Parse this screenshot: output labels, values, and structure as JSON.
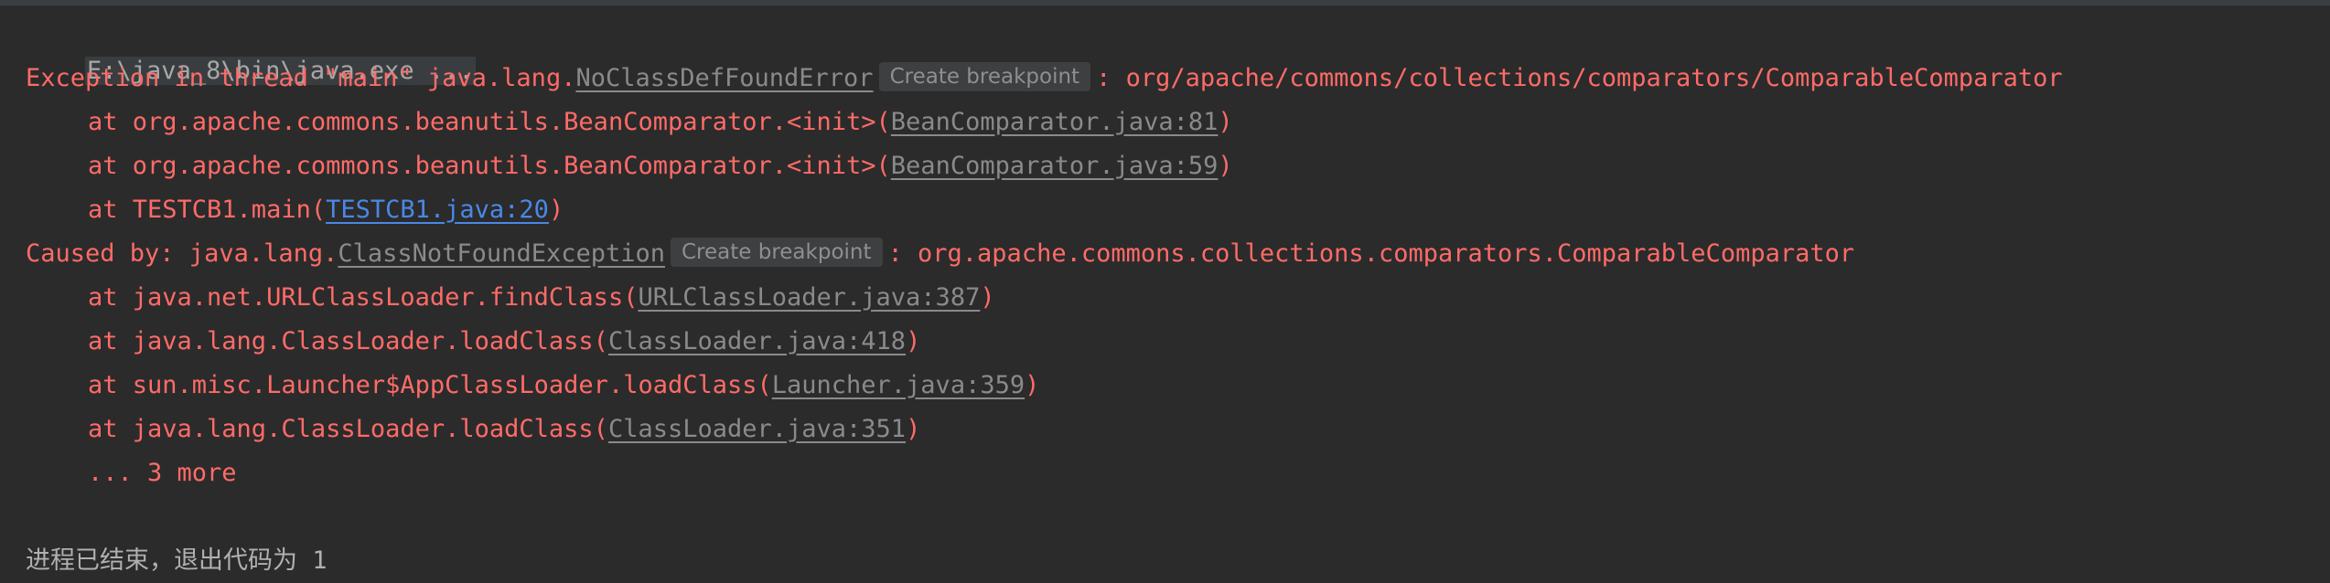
{
  "console": {
    "command": "E:\\java_8\\bin\\java.exe ...",
    "exception_prefix": "Exception in thread \"main\" java.lang.",
    "exception_class": "NoClassDefFoundError",
    "create_breakpoint_label": "Create breakpoint",
    "exception_message": ": org/apache/commons/collections/comparators/ComparableComparator",
    "stack1": [
      {
        "prefix": "at org.apache.commons.beanutils.BeanComparator.<init>(",
        "link": "BeanComparator.java:81",
        "suffix": ")"
      },
      {
        "prefix": "at org.apache.commons.beanutils.BeanComparator.<init>(",
        "link": "BeanComparator.java:59",
        "suffix": ")"
      },
      {
        "prefix": "at TESTCB1.main(",
        "link": "TESTCB1.java:20",
        "suffix": ")"
      }
    ],
    "caused_prefix": "Caused by: java.lang.",
    "caused_class": "ClassNotFoundException",
    "caused_message": ": org.apache.commons.collections.comparators.ComparableComparator",
    "stack2": [
      {
        "prefix": "at java.net.URLClassLoader.findClass(",
        "link": "URLClassLoader.java:387",
        "suffix": ")"
      },
      {
        "prefix": "at java.lang.ClassLoader.loadClass(",
        "link": "ClassLoader.java:418",
        "suffix": ")"
      },
      {
        "prefix": "at sun.misc.Launcher$AppClassLoader.loadClass(",
        "link": "Launcher.java:359",
        "suffix": ")"
      },
      {
        "prefix": "at java.lang.ClassLoader.loadClass(",
        "link": "ClassLoader.java:351",
        "suffix": ")"
      }
    ],
    "more": "... 3 more",
    "exit_message": "进程已结束，退出代码为 1"
  },
  "colors": {
    "background": "#2b2b2b",
    "error_text": "#ff6b68",
    "link_blue": "#4a88e6",
    "link_gray": "#8a8a8a"
  }
}
